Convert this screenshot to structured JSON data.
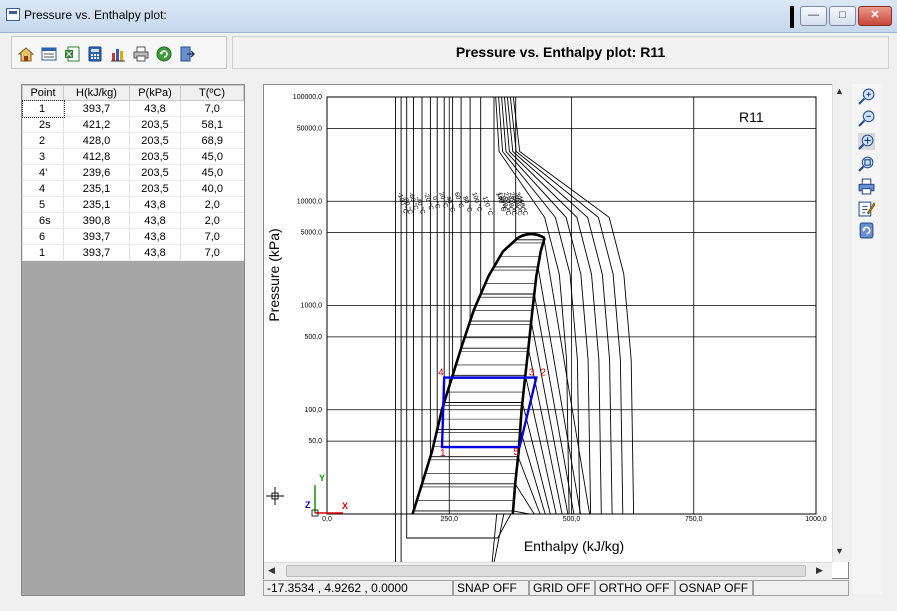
{
  "window": {
    "title": "Pressure vs. Enthalpy plot:",
    "min_glyph": "—",
    "max_glyph": "□",
    "close_glyph": "✕"
  },
  "toolbar": {
    "icons": [
      "home-icon",
      "open-window-icon",
      "export-excel-icon",
      "calculator-icon",
      "chart-icon",
      "print-icon",
      "refresh-icon",
      "exit-icon"
    ]
  },
  "header": {
    "title": "Pressure vs. Enthalpy plot: R11"
  },
  "table": {
    "columns": [
      "Point",
      "H(kJ/kg)",
      "P(kPa)",
      "T(ºC)"
    ],
    "rows": [
      [
        "1",
        "393,7",
        "43,8",
        "7,0"
      ],
      [
        "2s",
        "421,2",
        "203,5",
        "58,1"
      ],
      [
        "2",
        "428,0",
        "203,5",
        "68,9"
      ],
      [
        "3",
        "412,8",
        "203,5",
        "45,0"
      ],
      [
        "4'",
        "239,6",
        "203,5",
        "45,0"
      ],
      [
        "4",
        "235,1",
        "203,5",
        "40,0"
      ],
      [
        "5",
        "235,1",
        "43,8",
        "2,0"
      ],
      [
        "6s",
        "390,8",
        "43,8",
        "2,0"
      ],
      [
        "6",
        "393,7",
        "43,8",
        "7,0"
      ],
      [
        "1",
        "393,7",
        "43,8",
        "7,0"
      ]
    ]
  },
  "chart_data": {
    "type": "line",
    "title": "R11",
    "xlabel": "Enthalpy (kJ/kg)",
    "ylabel": "Pressure (kPa)",
    "xlim": [
      0,
      1000
    ],
    "ylim": [
      10,
      100000
    ],
    "yscale": "log",
    "x_ticks": [
      "0,0",
      "250,0",
      "500,0",
      "750,0",
      "1000,0"
    ],
    "y_ticks": [
      "100000,0",
      "50000,0",
      "10000,0",
      "5000,0",
      "1000,0",
      "500,0",
      "100,0",
      "50,0"
    ],
    "grid": true,
    "saturation_dome": {
      "liquid": {
        "h": [
          175,
          195,
          215,
          235,
          255,
          275,
          300,
          330,
          360,
          390
        ],
        "p": [
          10,
          20,
          40,
          100,
          200,
          400,
          900,
          1900,
          3300,
          4440
        ]
      },
      "vapor": {
        "h": [
          380,
          385,
          392,
          398,
          405,
          412,
          420,
          428,
          437,
          445
        ],
        "p": [
          10,
          20,
          40,
          100,
          200,
          400,
          900,
          1900,
          3300,
          4440
        ]
      }
    },
    "cycle": {
      "label": [
        "4",
        "3",
        "2",
        "5",
        "1"
      ],
      "h": [
        239.6,
        412.8,
        428.0,
        393.7,
        235.1
      ],
      "p": [
        203.5,
        203.5,
        203.5,
        43.8,
        43.8
      ]
    },
    "isotherm_labels": [
      "-100 °C",
      "-80 °C",
      "-60 °C",
      "-40 °C",
      "-20 °C",
      "0 °C",
      "20 °C",
      "40 °C",
      "60 °C",
      "80 °C",
      "100 °C",
      "120 °C",
      "140 °C",
      "160 °C",
      "180 °C",
      "200 °C",
      "220 °C",
      "240 °C",
      "260 °C",
      "280 °C",
      "300 °C"
    ],
    "axis_triad": {
      "x": "X",
      "y": "Y",
      "z": "Z"
    }
  },
  "right_toolbar": {
    "icons": [
      "zoom-in-icon",
      "zoom-out-icon",
      "zoom-window-icon",
      "zoom-extents-icon",
      "print-icon",
      "edit-properties-icon",
      "redraw-icon"
    ]
  },
  "status": {
    "coords": "-17.3534 , 4.9262 , 0.0000",
    "snap": "SNAP OFF",
    "grid": "GRID OFF",
    "ortho": "ORTHO OFF",
    "osnap": "OSNAP OFF"
  },
  "colors": {
    "cycle": "#0000e0",
    "cycle_labels": "#d00000",
    "triad_x": "#e00000",
    "triad_y": "#00a000",
    "triad_z": "#0000e0"
  }
}
